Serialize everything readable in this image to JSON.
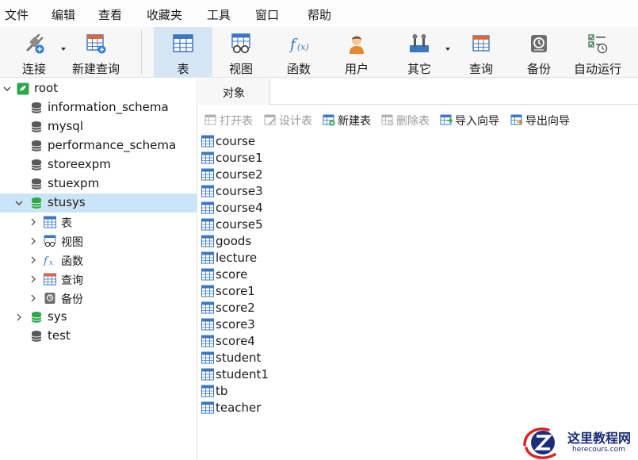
{
  "menubar": {
    "items": [
      "文件",
      "编辑",
      "查看",
      "收藏夹",
      "工具",
      "窗口",
      "帮助"
    ]
  },
  "toolbar": {
    "buttons": [
      {
        "label": "连接",
        "icon": "connection-plug-icon"
      },
      {
        "label": "新建查询",
        "icon": "new-query-icon"
      },
      {
        "label": "表",
        "icon": "table-icon",
        "active": true
      },
      {
        "label": "视图",
        "icon": "view-icon"
      },
      {
        "label": "函数",
        "icon": "function-fx-icon"
      },
      {
        "label": "用户",
        "icon": "user-icon"
      },
      {
        "label": "其它",
        "icon": "other-tools-icon"
      },
      {
        "label": "查询",
        "icon": "query-icon"
      },
      {
        "label": "备份",
        "icon": "backup-icon"
      },
      {
        "label": "自动运行",
        "icon": "schedule-icon"
      }
    ]
  },
  "sidebar": {
    "connection": "root",
    "databases": [
      {
        "name": "information_schema",
        "open": false
      },
      {
        "name": "mysql",
        "open": false
      },
      {
        "name": "performance_schema",
        "open": false
      },
      {
        "name": "storeexpm",
        "open": false
      },
      {
        "name": "stuexpm",
        "open": false
      },
      {
        "name": "stusys",
        "open": true,
        "selected": true
      },
      {
        "name": "sys",
        "open": true
      },
      {
        "name": "test",
        "open": false
      }
    ],
    "stusys_children": [
      "表",
      "视图",
      "函数",
      "查询",
      "备份"
    ]
  },
  "tabs": {
    "objects_label": "对象"
  },
  "object_toolbar": {
    "buttons": [
      {
        "label": "打开表",
        "enabled": false
      },
      {
        "label": "设计表",
        "enabled": false
      },
      {
        "label": "新建表",
        "enabled": true
      },
      {
        "label": "删除表",
        "enabled": false
      },
      {
        "label": "导入向导",
        "enabled": true
      },
      {
        "label": "导出向导",
        "enabled": true
      }
    ]
  },
  "tables": [
    "course",
    "course1",
    "course2",
    "course3",
    "course4",
    "course5",
    "goods",
    "lecture",
    "score",
    "score1",
    "score2",
    "score3",
    "score4",
    "student",
    "student1",
    "tb",
    "teacher"
  ],
  "watermark": {
    "site_name": "这里教程网",
    "url": "herecours.com"
  },
  "colors": {
    "active_toolbar_bg": "#d6e6f4",
    "selected_row_bg": "#cce4f7",
    "db_open_green": "#2aa84a",
    "db_closed_gray": "#5a5a5a",
    "table_icon_blue": "#3b78c4"
  }
}
